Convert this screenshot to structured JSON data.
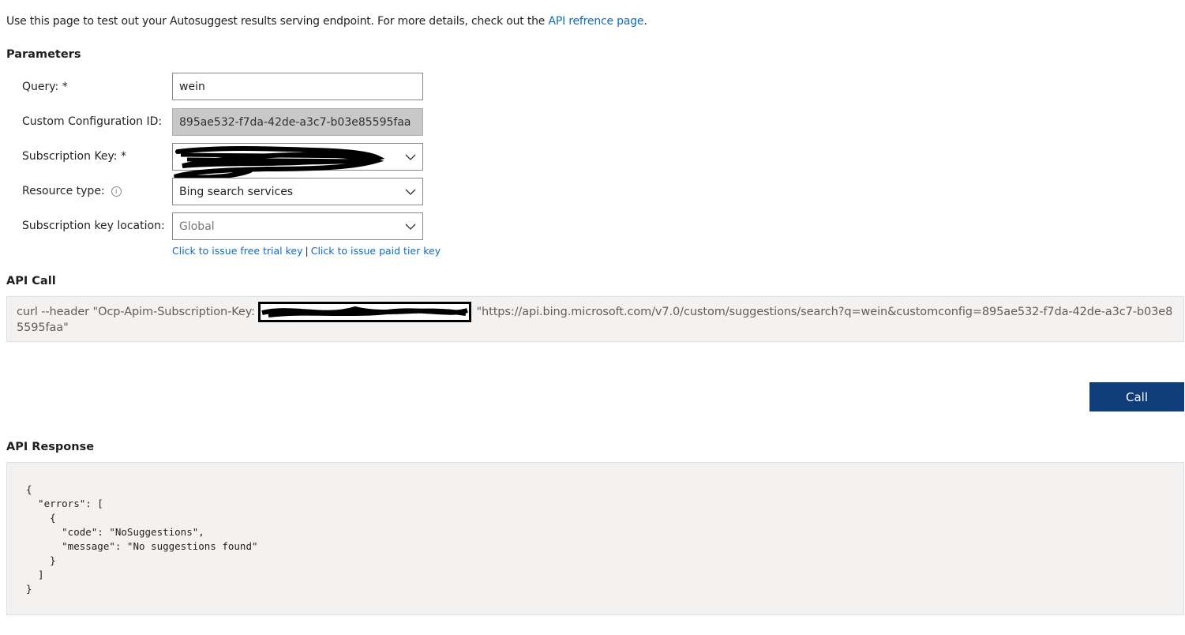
{
  "intro": {
    "text": "Use this page to test out your Autosuggest results serving endpoint. For more details, check out the ",
    "link": "API refrence page",
    "suffix": "."
  },
  "parameters": {
    "title": "Parameters",
    "query": {
      "label": "Query: *",
      "value": "wein"
    },
    "config_id": {
      "label": "Custom Configuration ID:",
      "value": "895ae532-f7da-42de-a3c7-b03e85595faa"
    },
    "subscription_key": {
      "label": "Subscription Key: *",
      "value": ""
    },
    "resource_type": {
      "label": "Resource type:",
      "value": "Bing search services",
      "info_icon": "info-icon"
    },
    "key_location": {
      "label": "Subscription key location:",
      "value": "Global"
    },
    "free_trial_link": "Click to issue free trial key",
    "separator": "|",
    "paid_link": "Click to issue paid tier key"
  },
  "api_call": {
    "title": "API Call",
    "prefix": "curl --header \"Ocp-Apim-Subscription-Key: ",
    "url": "\"https://api.bing.microsoft.com/v7.0/custom/suggestions/search?q=wein&customconfig=895ae532-f7da-42de-a3c7-b03e85595faa\""
  },
  "call_button": {
    "label": "Call"
  },
  "response": {
    "title": "API Response",
    "body": "{\n  \"errors\": [\n    {\n      \"code\": \"NoSuggestions\",\n      \"message\": \"No suggestions found\"\n    }\n  ]\n}"
  },
  "colors": {
    "link": "#0f6cbd",
    "button": "#0f3d7a",
    "panel": "#f3f2f1"
  }
}
